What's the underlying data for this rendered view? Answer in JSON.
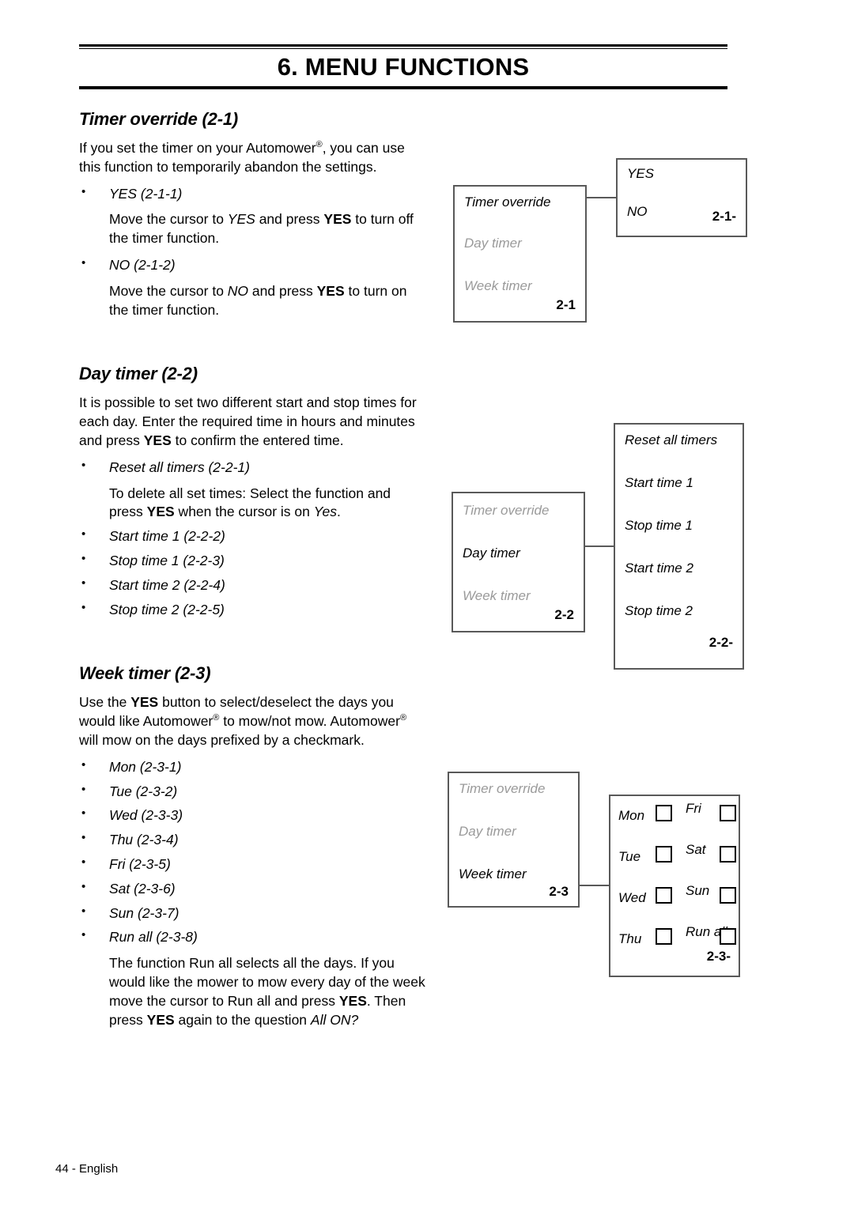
{
  "header": {
    "chapter_title": "6. MENU FUNCTIONS"
  },
  "sections": [
    {
      "heading": "Timer override (2-1)",
      "intro_parts": [
        {
          "t": "If you set the timer on your Automower",
          "s": "normal"
        },
        {
          "t": "®",
          "s": "sup"
        },
        {
          "t": ", you can use this function to temporarily abandon the settings.",
          "s": "normal"
        }
      ],
      "intro_plain": "If you set the timer on your Automower®, you can use this function to temporarily abandon the settings.",
      "bullets": [
        {
          "label": "YES (2-1-1)",
          "body_html": "Move the cursor to <i>YES</i> and press <b>YES</b> to turn off the timer function."
        },
        {
          "label": "NO (2-1-2)",
          "body_html": "Move the cursor to <i>NO</i> and press <b>YES</b> to turn on the timer function."
        }
      ]
    },
    {
      "heading": "Day timer (2-2)",
      "intro_html": "It is possible to set two different start and stop times for each day. Enter the required time in hours and minutes and press <b>YES</b> to confirm the entered time.",
      "bullets": [
        {
          "label": "Reset all timers (2-2-1)",
          "body_html": "To delete all set times: Select the function and press <b>YES</b> when the cursor is on <i>Yes</i>."
        },
        {
          "label": "Start time 1 (2-2-2)",
          "body_html": ""
        },
        {
          "label": "Stop time 1 (2-2-3)",
          "body_html": ""
        },
        {
          "label": "Start time 2 (2-2-4)",
          "body_html": ""
        },
        {
          "label": "Stop time 2 (2-2-5)",
          "body_html": ""
        }
      ]
    },
    {
      "heading": "Week timer (2-3)",
      "intro_html": "Use the <b>YES</b> button to select/deselect the days you would like Automower<sup>®</sup> to mow/not mow. Automower<sup>®</sup> will mow on the days prefixed by a checkmark.",
      "bullets": [
        {
          "label": "Mon (2-3-1)",
          "body_html": ""
        },
        {
          "label": "Tue (2-3-2)",
          "body_html": ""
        },
        {
          "label": "Wed (2-3-3)",
          "body_html": ""
        },
        {
          "label": "Thu (2-3-4)",
          "body_html": ""
        },
        {
          "label": "Fri (2-3-5)",
          "body_html": ""
        },
        {
          "label": "Sat (2-3-6)",
          "body_html": ""
        },
        {
          "label": "Sun (2-3-7)",
          "body_html": ""
        },
        {
          "label": "Run all (2-3-8)",
          "body_html": "The function Run all selects all the days. If you would like the mower to mow every day of the week move the cursor to Run all and press <b>YES</b>. Then press <b>YES</b> again to the question <i>All ON?</i>"
        }
      ]
    }
  ],
  "diagrams": {
    "timer_override": {
      "left_box": {
        "items": [
          {
            "label": "Timer override",
            "state": "active"
          },
          {
            "label": "Day timer",
            "state": "inactive"
          },
          {
            "label": "Week timer",
            "state": "inactive"
          }
        ],
        "code": "2-1"
      },
      "right_box": {
        "items": [
          {
            "label": "YES",
            "state": "active"
          },
          {
            "label": "NO",
            "state": "active"
          }
        ],
        "code": "2-1-"
      }
    },
    "day_timer": {
      "left_box": {
        "items": [
          {
            "label": "Timer override",
            "state": "inactive"
          },
          {
            "label": "Day timer",
            "state": "active"
          },
          {
            "label": "Week timer",
            "state": "inactive"
          }
        ],
        "code": "2-2"
      },
      "right_box": {
        "items": [
          {
            "label": "Reset all timers",
            "state": "active"
          },
          {
            "label": "Start time 1",
            "state": "active"
          },
          {
            "label": "Stop time 1",
            "state": "active"
          },
          {
            "label": "Start time 2",
            "state": "active"
          },
          {
            "label": "Stop time 2",
            "state": "active"
          }
        ],
        "code": "2-2-"
      }
    },
    "week_timer": {
      "left_box": {
        "items": [
          {
            "label": "Timer override",
            "state": "inactive"
          },
          {
            "label": "Day timer",
            "state": "inactive"
          },
          {
            "label": "Week timer",
            "state": "active"
          }
        ],
        "code": "2-3"
      },
      "right_box": {
        "left_column": [
          {
            "label": "Mon",
            "checked": false
          },
          {
            "label": "Tue",
            "checked": false
          },
          {
            "label": "Wed",
            "checked": false
          },
          {
            "label": "Thu",
            "checked": false
          }
        ],
        "right_column": [
          {
            "label": "Fri",
            "checked": false
          },
          {
            "label": "Sat",
            "checked": false
          },
          {
            "label": "Sun",
            "checked": false
          },
          {
            "label": "Run all",
            "checked": false
          }
        ],
        "code": "2-3-"
      }
    }
  },
  "footer": {
    "page_label": "44 - English"
  },
  "colors": {
    "text": "#000000",
    "inactive_menu": "#9a9a9a",
    "box_border": "#595959"
  }
}
